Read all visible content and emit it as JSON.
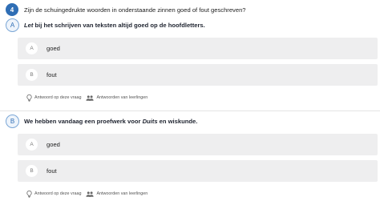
{
  "question": {
    "number": "4",
    "text": "Zijn de schuingedrukte woorden in onderstaande zinnen goed of fout geschreven?"
  },
  "items": [
    {
      "letter": "A",
      "sentence": {
        "italic": "Let",
        "rest": " bij het schrijven van teksten altijd goed op de hoofdletters."
      },
      "options": [
        {
          "letter": "A",
          "label": "goed"
        },
        {
          "letter": "B",
          "label": "fout"
        }
      ],
      "footer": {
        "answer_label": "Antwoord op deze vraag",
        "students_label": "Antwoorden van leerlingen"
      }
    },
    {
      "letter": "B",
      "sentence": {
        "before": "We hebben vandaag een proefwerk voor ",
        "italic": "Duits",
        "after": " en wiskunde."
      },
      "options": [
        {
          "letter": "A",
          "label": "goed"
        },
        {
          "letter": "B",
          "label": "fout"
        }
      ],
      "footer": {
        "answer_label": "Antwoord op deze vraag",
        "students_label": "Antwoorden van leerlingen"
      }
    }
  ],
  "icons": {
    "answer": "lightbulb-icon",
    "students": "people-icon"
  },
  "colors": {
    "accent": "#2f6eb5",
    "option_bg": "#eeeeef"
  }
}
